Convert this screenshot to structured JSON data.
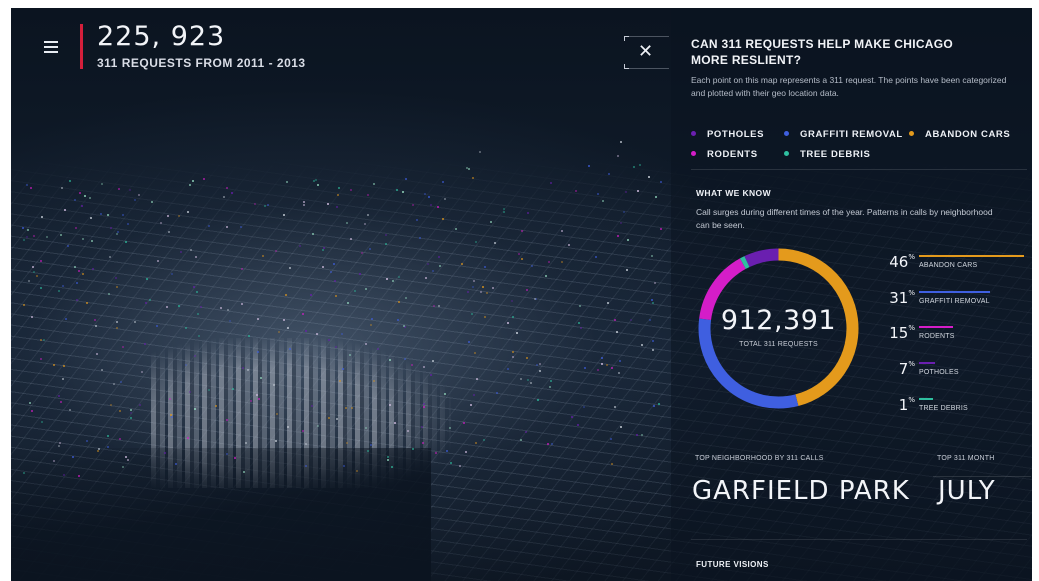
{
  "header": {
    "request_count": "225, 923",
    "subtitle": "311 REQUESTS FROM 2011 - 2013"
  },
  "panel": {
    "title": "CAN 311 REQUESTS HELP MAKE CHICAGO MORE RESLIENT?",
    "description": "Each point on this map represents a 311 request. The points have been categorized and plotted with their geo location data.",
    "legend": [
      {
        "label": "POTHOLES",
        "color": "#6a1fb0"
      },
      {
        "label": "GRAFFITI REMOVAL",
        "color": "#3f5fe0"
      },
      {
        "label": "ABANDON CARS",
        "color": "#e49a1c"
      },
      {
        "label": "RODENTS",
        "color": "#d51dc8"
      },
      {
        "label": "TREE DEBRIS",
        "color": "#2fc0a0"
      }
    ],
    "what_we_know": {
      "title": "WHAT WE KNOW",
      "description": "Call surges during different times of the year. Patterns in calls by neighborhood can be seen."
    },
    "total": {
      "value": "912,391",
      "label": "TOTAL 311 REQUESTS"
    },
    "stats": [
      {
        "percent": "46",
        "label": "ABANDON CARS",
        "color": "#e49a1c",
        "fraction": 0.46
      },
      {
        "percent": "31",
        "label": "GRAFFITI REMOVAL",
        "color": "#3f5fe0",
        "fraction": 0.31
      },
      {
        "percent": "15",
        "label": "RODENTS",
        "color": "#d51dc8",
        "fraction": 0.15
      },
      {
        "percent": "7",
        "label": "POTHOLES",
        "color": "#6a1fb0",
        "fraction": 0.07
      },
      {
        "percent": "1",
        "label": "TREE DEBRIS",
        "color": "#2fc0a0",
        "fraction": 0.01
      }
    ],
    "percent_mark": "%",
    "top_neighborhood": {
      "label": "TOP NEIGHBORHOOD BY 311 CALLS",
      "value": "GARFIELD PARK"
    },
    "top_month": {
      "label": "TOP 311 MONTH",
      "value": "JULY"
    },
    "next_section": "FUTURE VISIONS"
  },
  "icons": {
    "menu": "hamburger-menu-icon",
    "close": "close-icon"
  },
  "colors": {
    "accent": "#d41f3b",
    "background": "#0b1420"
  }
}
